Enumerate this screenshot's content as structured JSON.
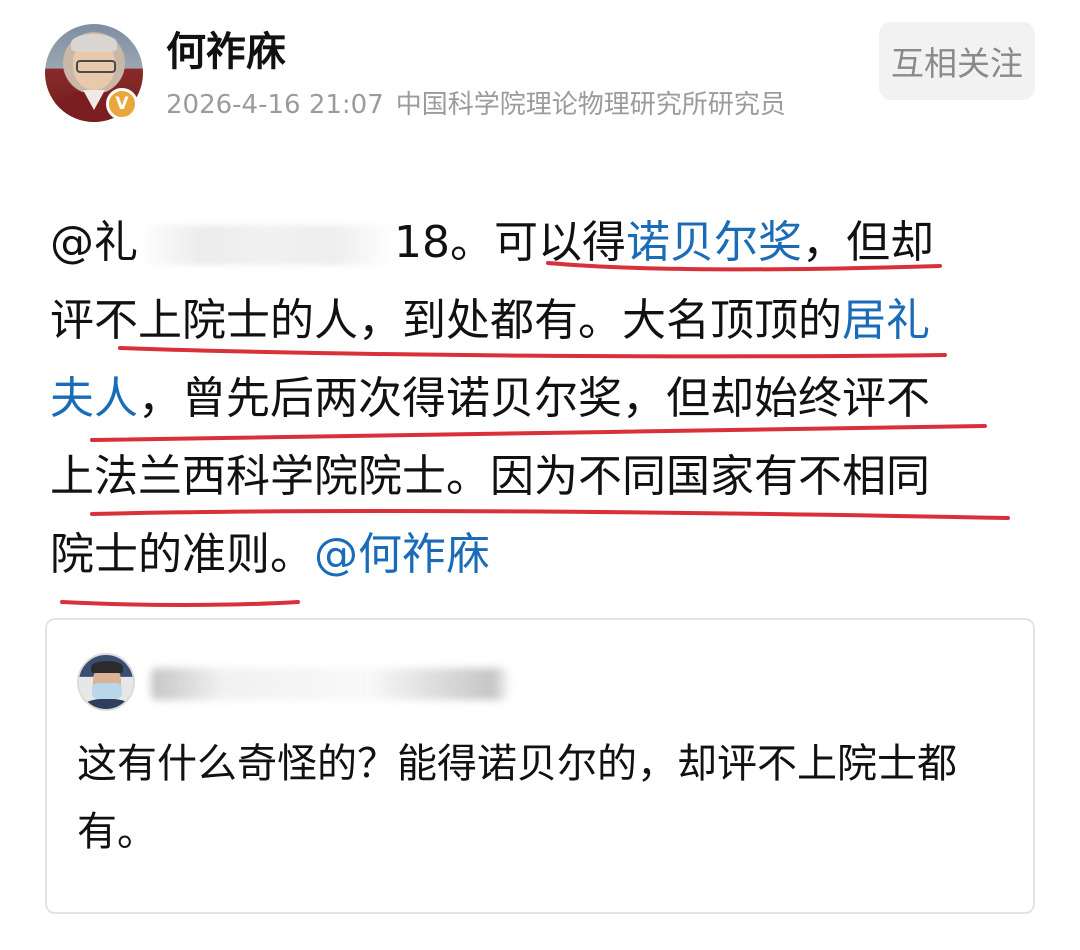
{
  "header": {
    "username": "何祚庥",
    "badge": "V",
    "timestamp": "2026-4-16 21:07",
    "bio": "中国科学院理论物理研究所研究员",
    "follow_label": "互相关注"
  },
  "post": {
    "line1": {
      "prefix": "@礼",
      "suffix": "18。可以得",
      "link": "诺贝尔奖",
      "after": "，但却"
    },
    "line2": {
      "text": "评不上院士的人，到处都有。大名顶顶的",
      "link": "居礼"
    },
    "line3": {
      "link": "夫人",
      "text": "，曾先后两次得诺贝尔奖，但却始终评不"
    },
    "line4": {
      "text": "上法兰西科学院院士。因为不同国家有不相同"
    },
    "line5": {
      "text": "院士的准则。",
      "mention": "@何祚庥"
    }
  },
  "quote": {
    "text": "这有什么奇怪的？能得诺贝尔的，却评不上院士都有。"
  },
  "colors": {
    "link": "#1a6bb8",
    "underline": "#d9303a",
    "badge": "#e8a73a",
    "meta": "#9b9b9b"
  }
}
